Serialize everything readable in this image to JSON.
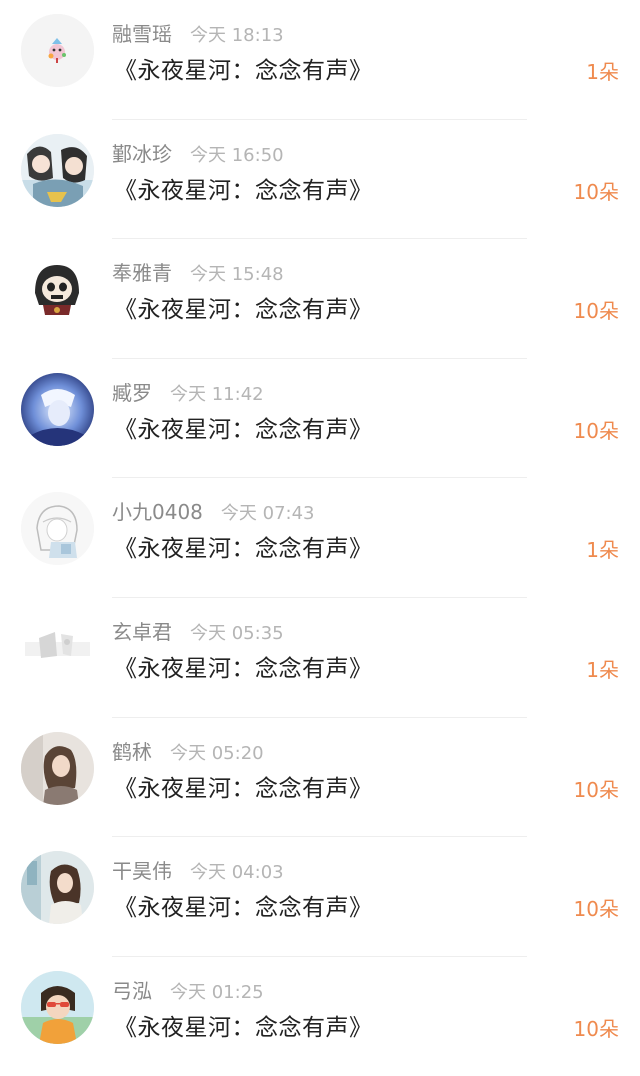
{
  "colors": {
    "username": "#8a8a8a",
    "time": "#b5b5b5",
    "gift_text": "#222222",
    "count": "#ef8a4e",
    "divider": "#eeeeee"
  },
  "records": [
    {
      "username": "融雪瑶",
      "time": "今天 18:13",
      "gift": "《永夜星河：念念有声》",
      "count": "1朵",
      "avatar_icon": "cartoon-mascot-avatar"
    },
    {
      "username": "鄞冰珍",
      "time": "今天 16:50",
      "gift": "《永夜星河：念念有声》",
      "count": "10朵",
      "avatar_icon": "anime-couple-avatar"
    },
    {
      "username": "奉雅青",
      "time": "今天 15:48",
      "gift": "《永夜星河：念念有声》",
      "count": "10朵",
      "avatar_icon": "hooded-skull-avatar"
    },
    {
      "username": "臧罗",
      "time": "今天 11:42",
      "gift": "《永夜星河：念念有声》",
      "count": "10朵",
      "avatar_icon": "blue-anime-avatar"
    },
    {
      "username": "小九0408",
      "time": "今天 07:43",
      "gift": "《永夜星河：念念有声》",
      "count": "1朵",
      "avatar_icon": "sketch-character-avatar"
    },
    {
      "username": "玄卓君",
      "time": "今天 05:35",
      "gift": "《永夜星河：念念有声》",
      "count": "1朵",
      "avatar_icon": "faded-photo-avatar"
    },
    {
      "username": "鹤秫",
      "time": "今天 05:20",
      "gift": "《永夜星河：念念有声》",
      "count": "10朵",
      "avatar_icon": "woman-portrait-avatar"
    },
    {
      "username": "干昊伟",
      "time": "今天 04:03",
      "gift": "《永夜星河：念念有声》",
      "count": "10朵",
      "avatar_icon": "girl-photo-avatar"
    },
    {
      "username": "弓泓",
      "time": "今天 01:25",
      "gift": "《永夜星河：念念有声》",
      "count": "10朵",
      "avatar_icon": "sunglasses-girl-avatar"
    }
  ]
}
